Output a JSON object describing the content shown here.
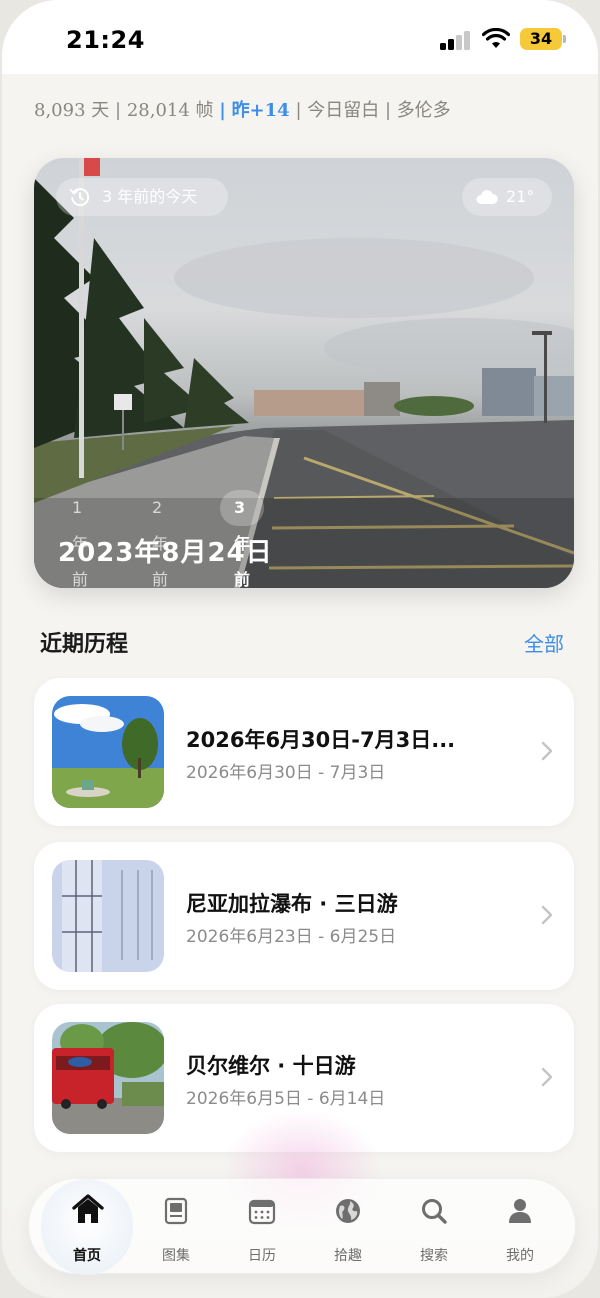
{
  "status_bar": {
    "time": "21:24",
    "battery": "34"
  },
  "stats_line": {
    "days": "8,093 天",
    "frames": "28,014 帧",
    "yesterday": "昨+14",
    "note": "今日留白",
    "city": "多伦多",
    "separator": "|",
    "highlight_color": "#3d8ee8"
  },
  "memory_card": {
    "history_label": "3 年前的今天",
    "temperature": "21°",
    "year_tabs": [
      {
        "label": "1年前",
        "active": false
      },
      {
        "label": "2年前",
        "active": false
      },
      {
        "label": "3年前",
        "active": true
      }
    ],
    "date": "2023年8月24日",
    "icons": {
      "history": "clock-history-icon",
      "weather": "cloud-icon"
    }
  },
  "recent": {
    "title": "近期历程",
    "all_link": "全部",
    "link_color": "#3d8ee8",
    "items": [
      {
        "title": "2026年6月30日-7月3日...",
        "range": "2026年6月30日 - 7月3日"
      },
      {
        "title": "尼亚加拉瀑布 · 三日游",
        "range": "2026年6月23日 - 6月25日"
      },
      {
        "title": "贝尔维尔 · 十日游",
        "range": "2026年6月5日 - 6月14日"
      }
    ]
  },
  "tab_bar": {
    "items": [
      {
        "label": "首页",
        "icon": "home-icon",
        "active": true
      },
      {
        "label": "图集",
        "icon": "album-icon",
        "active": false
      },
      {
        "label": "日历",
        "icon": "calendar-icon",
        "active": false
      },
      {
        "label": "拾趣",
        "icon": "globe-icon",
        "active": false
      },
      {
        "label": "搜索",
        "icon": "search-icon",
        "active": false
      },
      {
        "label": "我的",
        "icon": "person-icon",
        "active": false
      }
    ]
  }
}
